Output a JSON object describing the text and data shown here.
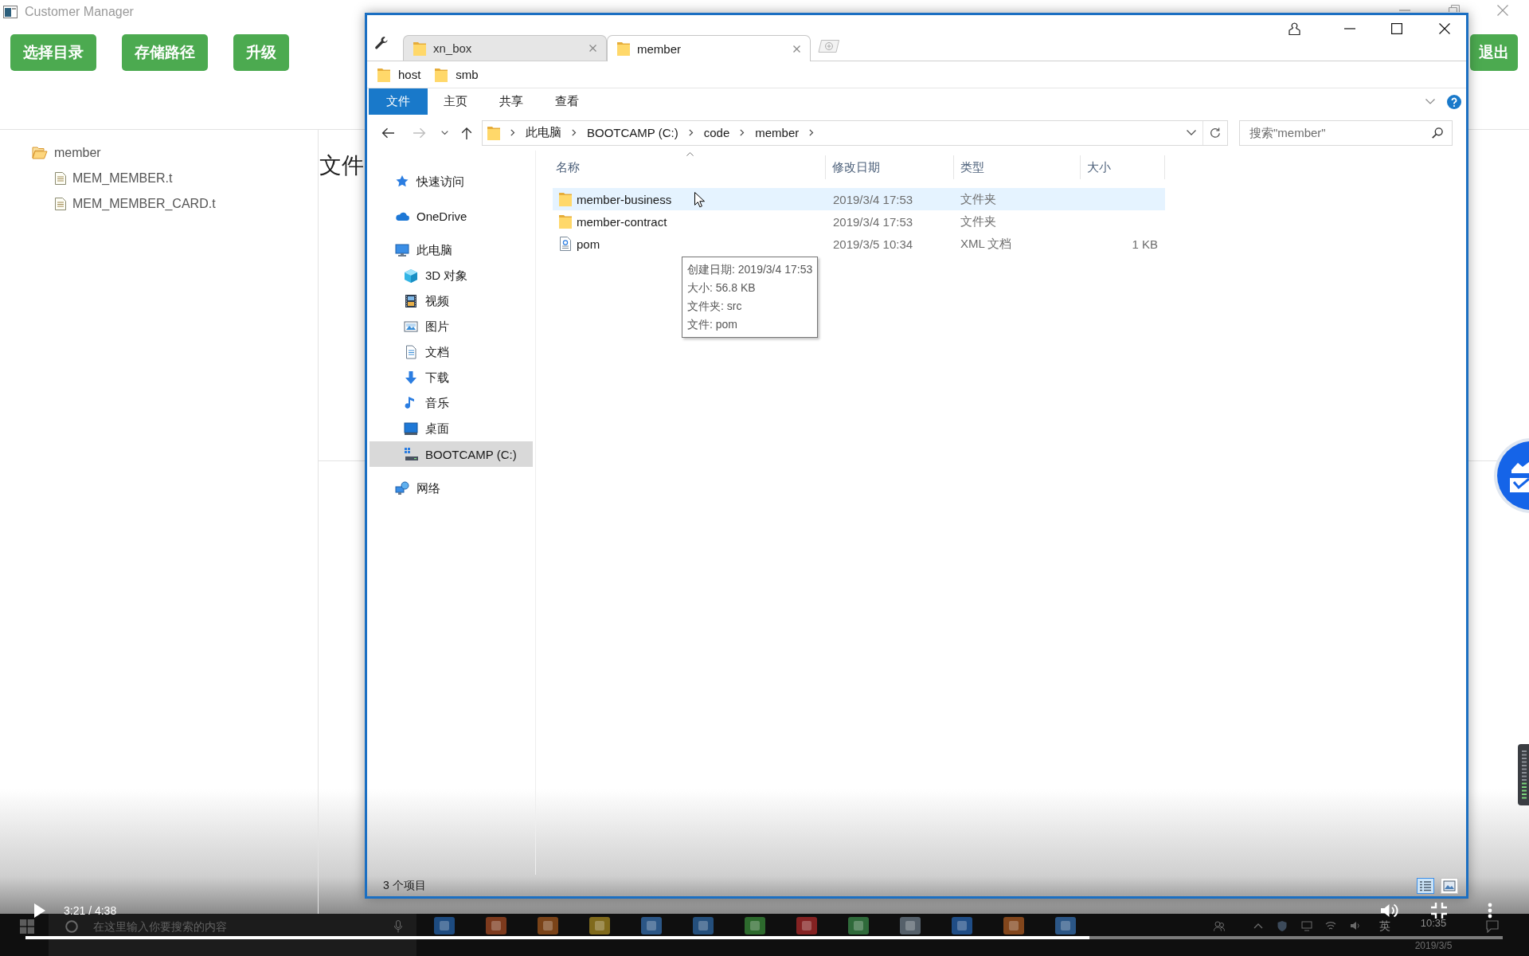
{
  "app": {
    "title": "Customer Manager",
    "toolbar_buttons": [
      {
        "label": "选择目录"
      },
      {
        "label": "存储路径"
      },
      {
        "label": "升级"
      }
    ],
    "exit_button": {
      "label": "退出"
    },
    "tree": [
      {
        "label": "member",
        "kind": "folder",
        "expanded": true,
        "children": [
          {
            "label": "MEM_MEMBER.t",
            "kind": "file"
          },
          {
            "label": "MEM_MEMBER_CARD.t",
            "kind": "file"
          }
        ]
      }
    ],
    "content_heading": "文件"
  },
  "explorer": {
    "tabs": [
      {
        "label": "xn_box",
        "selected": false
      },
      {
        "label": "member",
        "selected": true
      }
    ],
    "bookmarks": [
      {
        "label": "host"
      },
      {
        "label": "smb"
      }
    ],
    "ribbon_tabs": [
      {
        "label": "文件",
        "selected": true
      },
      {
        "label": "主页",
        "selected": false
      },
      {
        "label": "共享",
        "selected": false
      },
      {
        "label": "查看",
        "selected": false
      }
    ],
    "breadcrumbs": [
      "此电脑",
      "BOOTCAMP (C:)",
      "code",
      "member"
    ],
    "search": {
      "placeholder": "搜索\"member\""
    },
    "nav": [
      {
        "label": "快速访问",
        "kind": "star",
        "selected": false
      },
      {
        "label": "OneDrive",
        "kind": "cloud",
        "selected": false
      },
      {
        "label": "此电脑",
        "kind": "computer",
        "selected": false,
        "children": [
          {
            "label": "3D 对象",
            "kind": "cube",
            "selected": false
          },
          {
            "label": "视频",
            "kind": "film",
            "selected": false
          },
          {
            "label": "图片",
            "kind": "picture",
            "selected": false
          },
          {
            "label": "文档",
            "kind": "document",
            "selected": false
          },
          {
            "label": "下载",
            "kind": "download",
            "selected": false
          },
          {
            "label": "音乐",
            "kind": "music",
            "selected": false
          },
          {
            "label": "桌面",
            "kind": "desktop",
            "selected": false
          },
          {
            "label": "BOOTCAMP (C:)",
            "kind": "drive",
            "selected": true
          }
        ]
      },
      {
        "label": "网络",
        "kind": "network",
        "selected": false
      }
    ],
    "columns": [
      {
        "label": "名称",
        "sorted": true
      },
      {
        "label": "修改日期",
        "sorted": false
      },
      {
        "label": "类型",
        "sorted": false
      },
      {
        "label": "大小",
        "sorted": false
      }
    ],
    "rows": [
      {
        "name": "member-business",
        "modified": "2019/3/4 17:53",
        "type": "文件夹",
        "kind": "folder",
        "hovered": true
      },
      {
        "name": "member-contract",
        "modified": "2019/3/4 17:53",
        "type": "文件夹",
        "kind": "folder",
        "hovered": false
      },
      {
        "name": "pom",
        "modified": "2019/3/5 10:34",
        "type": "XML 文档",
        "size": "1 KB",
        "kind": "xml",
        "hovered": false
      }
    ],
    "tooltip": [
      "创建日期: 2019/3/4 17:53",
      "大小: 56.8 KB",
      "文件夹: src",
      "文件: pom"
    ],
    "status": "3 个项目",
    "views": [
      {
        "kind": "details",
        "selected": true
      },
      {
        "kind": "large-icons",
        "selected": false
      }
    ]
  },
  "player": {
    "playing": false,
    "time": "3:21 / 4:38",
    "progress": {
      "level": 0.72
    }
  },
  "taskbar": {
    "search": {
      "placeholder": "在这里输入你要搜索的内容"
    },
    "input_method": "英",
    "clock": "10:35",
    "date": "2019/3/5"
  }
}
